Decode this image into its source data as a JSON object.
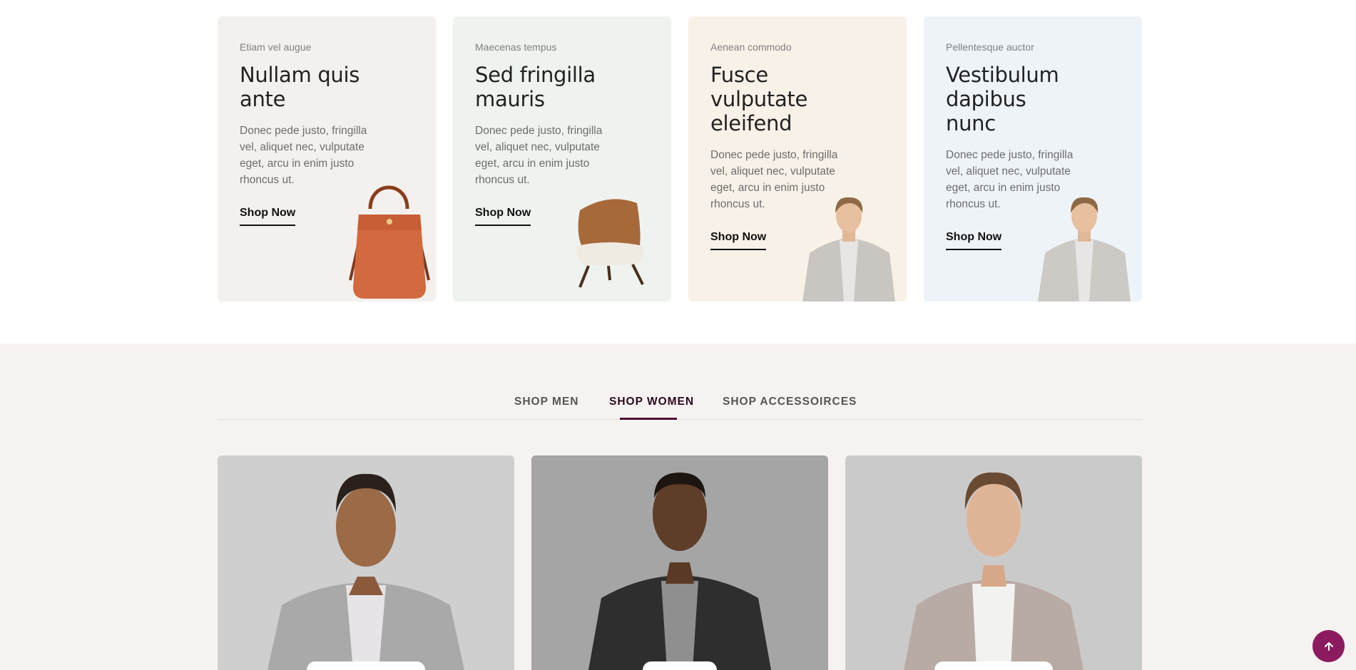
{
  "promo_cards": [
    {
      "eyebrow": "Etiam vel augue",
      "title": "Nullam quis ante",
      "description": "Donec pede justo, fringilla vel, aliquet nec, vulputate eget, arcu in enim justo rhoncus ut.",
      "cta": "Shop Now",
      "bg": "#f4f0ee",
      "product": "handbag"
    },
    {
      "eyebrow": "Maecenas tempus",
      "title": "Sed fringilla mauris",
      "description": "Donec pede justo, fringilla vel, aliquet nec, vulputate eget, arcu in enim justo rhoncus ut.",
      "cta": "Shop Now",
      "bg": "#eef3ef",
      "product": "armchair"
    },
    {
      "eyebrow": "Aenean commodo",
      "title": "Fusce vulputate eleifend",
      "description": "Donec pede justo, fringilla vel, aliquet nec, vulputate eget, arcu in enim justo rhoncus ut.",
      "cta": "Shop Now",
      "bg": "#f8f1e7",
      "product": "man-in-blazer"
    },
    {
      "eyebrow": "Pellentesque auctor",
      "title": "Vestibulum dapibus nunc",
      "description": "Donec pede justo, fringilla vel, aliquet nec, vulputate eget, arcu in enim justo rhoncus ut.",
      "cta": "Shop Now",
      "bg": "#eef3f8",
      "product": "man-in-blazer"
    }
  ],
  "tabs": [
    {
      "label": "SHOP MEN",
      "active": false
    },
    {
      "label": "SHOP WOMEN",
      "active": true
    },
    {
      "label": "SHOP ACCESSOIRCES",
      "active": false
    }
  ],
  "products": [
    {
      "photo": "man-grey-blazer",
      "bg": "#cfcfcf"
    },
    {
      "photo": "man-black-jacket",
      "bg": "#a5a5a5"
    },
    {
      "photo": "man-beige-blazer",
      "bg": "#cbcaca"
    }
  ],
  "colors": {
    "accent": "#8b1b5e",
    "tab_active": "#4a1034",
    "section_bg": "#f7f2f2"
  },
  "back_to_top_icon": "arrow-up-icon"
}
